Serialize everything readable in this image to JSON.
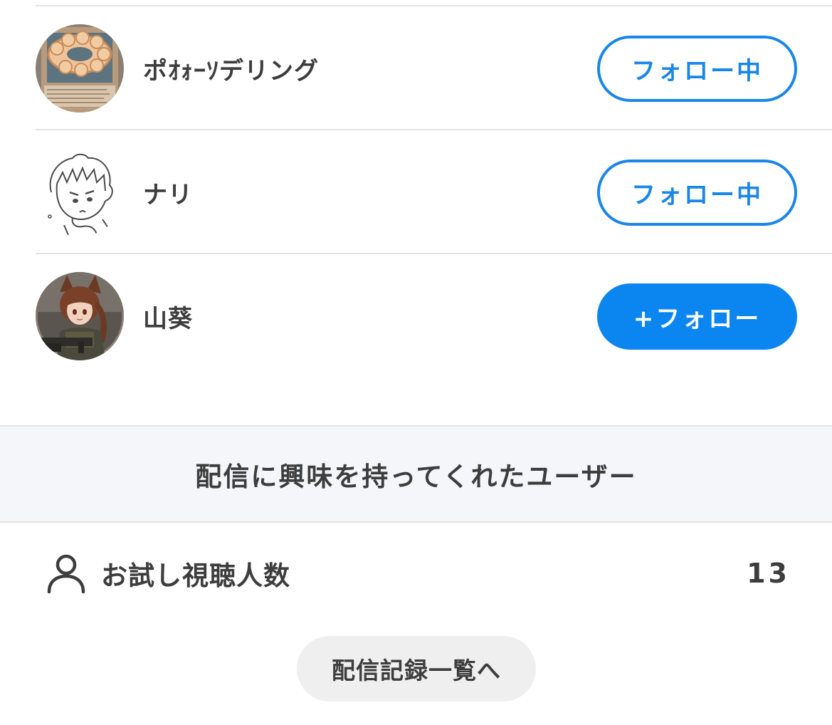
{
  "users": [
    {
      "name": "ポｵｫｰｿデリング",
      "follow_label": "フォロー中",
      "following": true,
      "avatar_icon": "donut-card-avatar"
    },
    {
      "name": "ナリ",
      "follow_label": "フォロー中",
      "following": true,
      "avatar_icon": "sketch-face-avatar"
    },
    {
      "name": "山葵",
      "follow_label": "+フォロー",
      "following": false,
      "avatar_icon": "anime-girl-avatar"
    }
  ],
  "interested_section": {
    "title": "配信に興味を持ってくれたユーザー"
  },
  "trial_viewers": {
    "icon": "person-icon",
    "label": "お試し視聴人数",
    "count": "13"
  },
  "history_button": {
    "label": "配信記録一覧へ"
  },
  "colors": {
    "accent": "#0b85f0",
    "text": "#3d3d3d",
    "section_bg": "#f5f6f9",
    "divider": "#e3e3e3",
    "secondary_button_bg": "#efefef"
  }
}
